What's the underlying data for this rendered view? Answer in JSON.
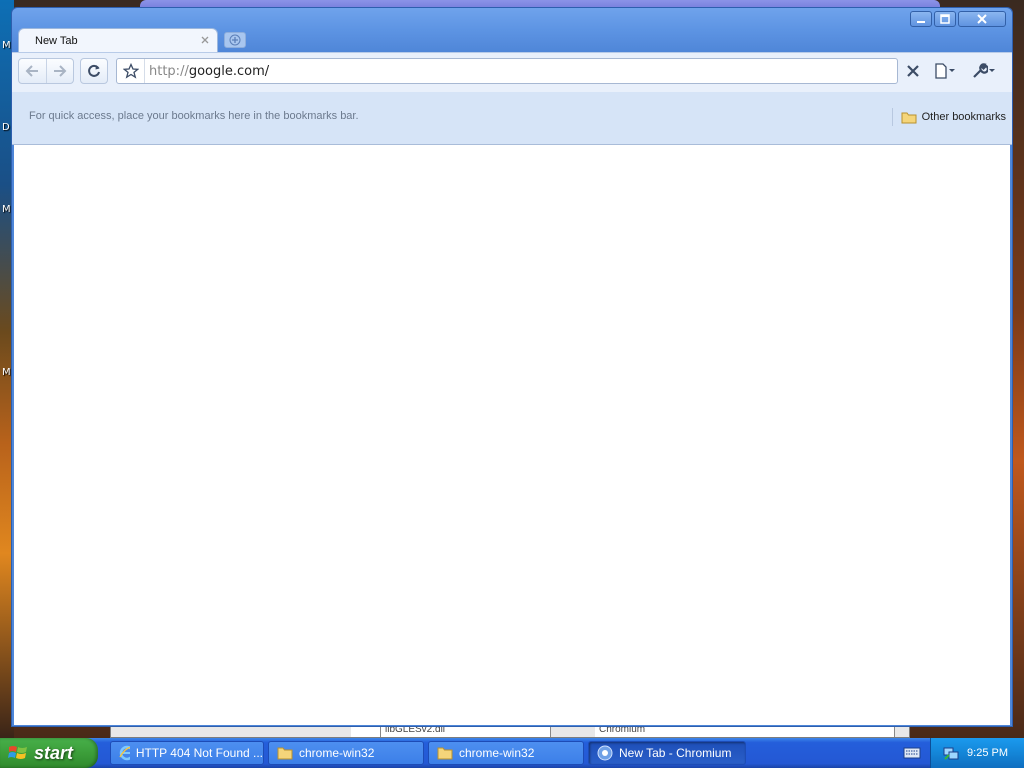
{
  "desktop": {
    "letters": [
      "M",
      "D",
      "M",
      "M"
    ],
    "background_window_cells": [
      "libGLESv2.dll",
      "Chromium"
    ]
  },
  "browser": {
    "tab": {
      "title": "New Tab"
    },
    "omnibox": {
      "scheme": "http://",
      "host": "google.com/"
    },
    "bookmarks_bar": {
      "hint": "For quick access, place your bookmarks here in the bookmarks bar.",
      "other_bookmarks": "Other bookmarks"
    }
  },
  "taskbar": {
    "start_label": "start",
    "tasks": [
      {
        "label": "HTTP 404 Not Found ...",
        "icon": "ie-icon"
      },
      {
        "label": "chrome-win32",
        "icon": "folder-icon"
      },
      {
        "label": "chrome-win32",
        "icon": "folder-icon"
      },
      {
        "label": "New Tab - Chromium",
        "icon": "chromium-icon",
        "active": true
      }
    ],
    "clock": "9:25 PM"
  },
  "colors": {
    "titlebar": "#5d94e3",
    "toolbar": "#e9f0fb",
    "bookmarks_bar": "#d6e4f7",
    "taskbar": "#245edb",
    "start_button": "#3c9e3a"
  }
}
